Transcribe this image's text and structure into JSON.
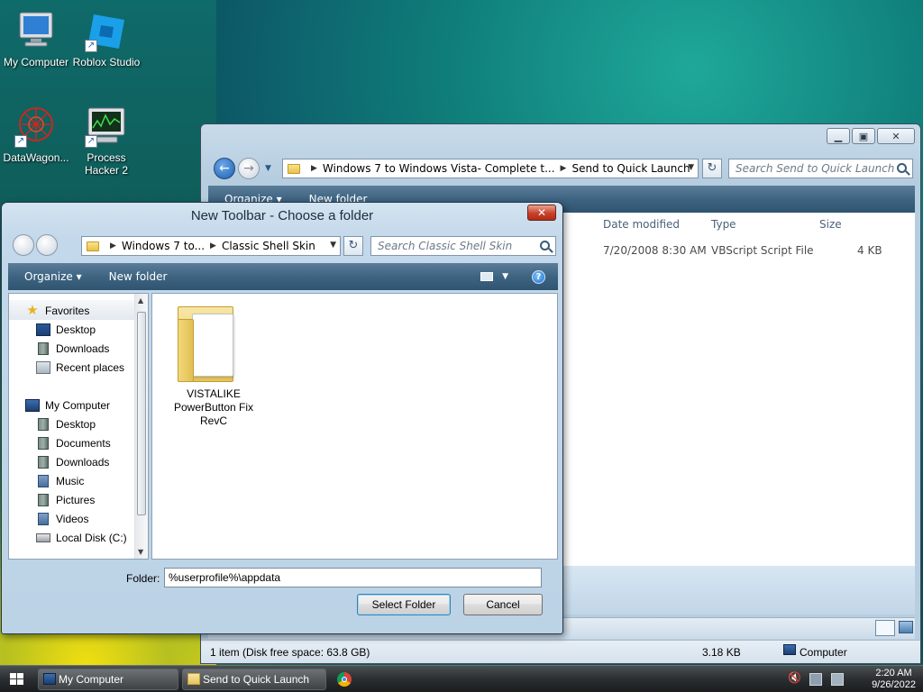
{
  "desktop": {
    "icons": [
      {
        "label": "My Computer",
        "icon": "computer-icon"
      },
      {
        "label": "Roblox Studio",
        "icon": "roblox-studio-icon"
      },
      {
        "label": "DataWagon...",
        "icon": "datawagon-icon"
      },
      {
        "label_line1": "Process",
        "label_line2": "Hacker 2",
        "icon": "process-hacker-icon"
      }
    ]
  },
  "explorer": {
    "address": {
      "crumbs": [
        "Windows 7 to Windows Vista- Complete t...",
        "Send to Quick Launch"
      ]
    },
    "search_placeholder": "Search Send to Quick Launch",
    "toolbar": {
      "organize": "Organize ▾",
      "new_folder": "New folder"
    },
    "columns": {
      "date_modified": "Date modified",
      "type": "Type",
      "size": "Size"
    },
    "row": {
      "date": "7/20/2008 8:30 AM",
      "type": "VBScript Script File",
      "size": "4 KB"
    },
    "status": {
      "items": "1 item (Disk free space: 63.8 GB)",
      "size": "3.18 KB",
      "location": "Computer"
    }
  },
  "dialog": {
    "title": "New Toolbar - Choose a folder",
    "close_label": "✕",
    "address": {
      "crumbs": [
        "Windows 7 to...",
        "Classic Shell Skin"
      ]
    },
    "search_placeholder": "Search Classic Shell Skin",
    "toolbar": {
      "organize": "Organize ▾",
      "new_folder": "New folder"
    },
    "tree": {
      "favorites_header": "Favorites",
      "favorites": [
        "Desktop",
        "Downloads",
        "Recent places"
      ],
      "computer_header": "My Computer",
      "computer": [
        "Desktop",
        "Documents",
        "Downloads",
        "Music",
        "Pictures",
        "Videos",
        "Local Disk (C:)"
      ]
    },
    "folder_item": {
      "line1": "VISTALIKE",
      "line2": "PowerButton Fix",
      "line3": "RevC"
    },
    "folder_label": "Folder:",
    "folder_value": "%userprofile%\\appdata",
    "select_button": "Select Folder",
    "cancel_button": "Cancel"
  },
  "taskbar": {
    "buttons": [
      "My Computer",
      "Send to Quick Launch"
    ],
    "time": "2:20 AM",
    "date": "9/26/2022"
  }
}
